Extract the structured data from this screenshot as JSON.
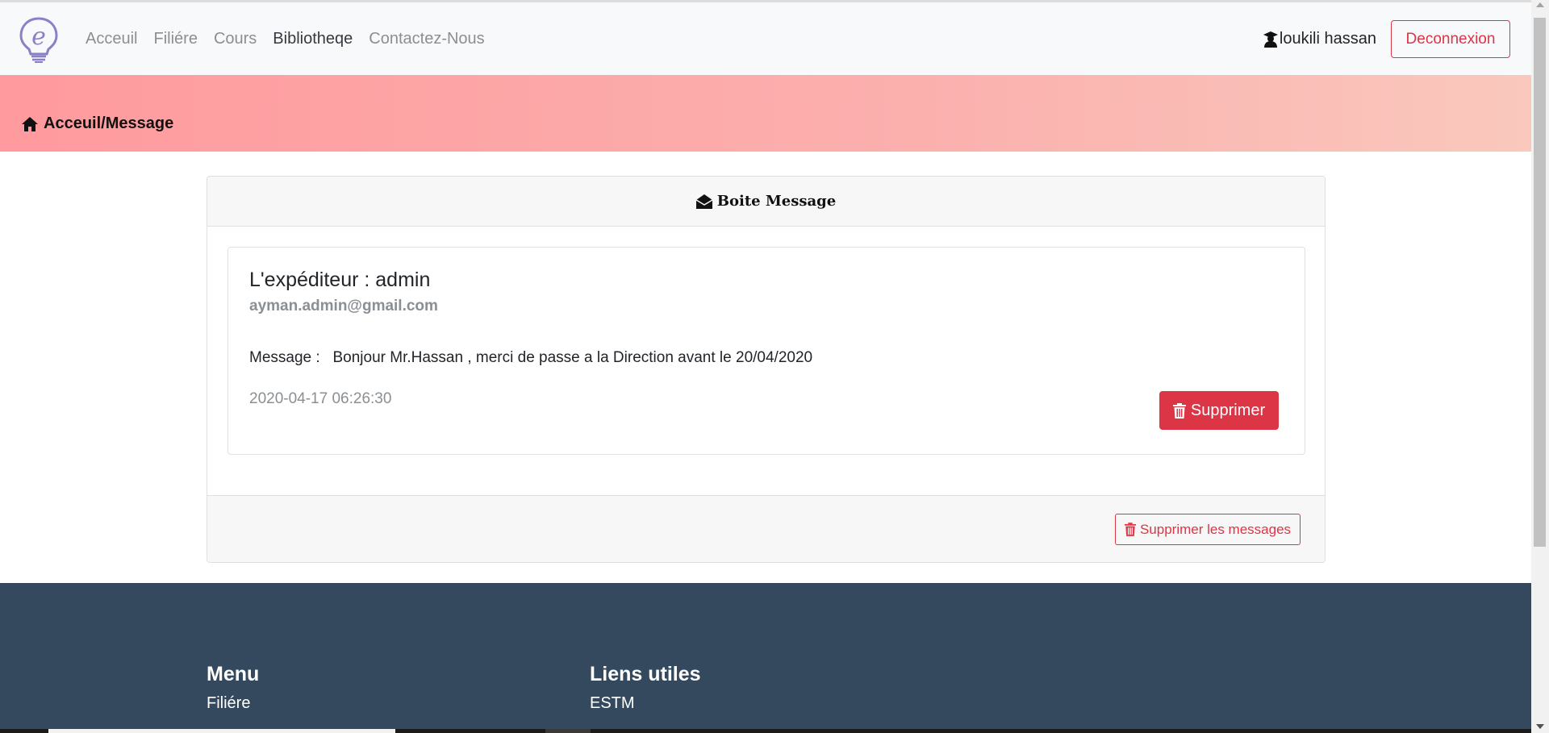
{
  "navbar": {
    "links": [
      {
        "label": "Acceuil"
      },
      {
        "label": "Filiére"
      },
      {
        "label": "Cours"
      },
      {
        "label": "Bibliotheqe"
      },
      {
        "label": "Contactez-Nous"
      }
    ],
    "user_name": "loukili hassan",
    "logout_label": "Deconnexion"
  },
  "banner": {
    "breadcrumb": "Acceuil/Message"
  },
  "card": {
    "title": "Boite Message",
    "message": {
      "sender": "L'expéditeur : admin",
      "email": "ayman.admin@gmail.com",
      "body": "Message :   Bonjour Mr.Hassan , merci de passe a la Direction avant le 20/04/2020",
      "date": "2020-04-17 06:26:30",
      "delete_label": "Supprimer"
    },
    "delete_all_label": "Supprimer les messages"
  },
  "footer": {
    "menu_title": "Menu",
    "menu_items": [
      "Filiére"
    ],
    "links_title": "Liens utiles",
    "links_items": [
      "ESTM"
    ]
  },
  "colors": {
    "danger": "#dc3545",
    "footer_bg": "#34495e",
    "navbar_bg": "#f8f9fa"
  }
}
